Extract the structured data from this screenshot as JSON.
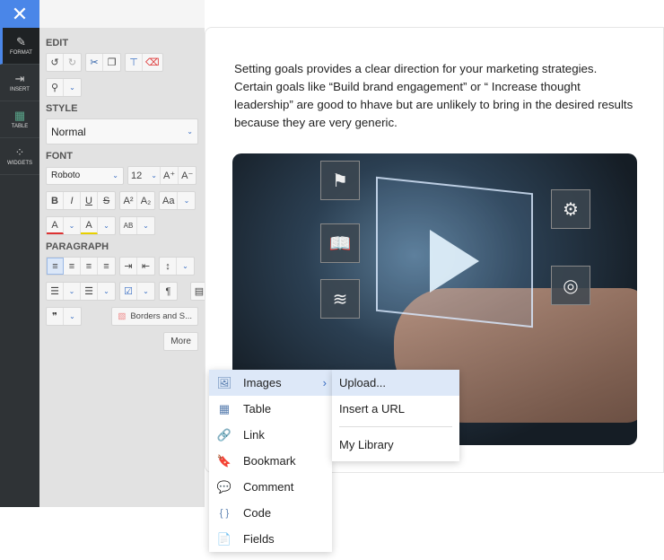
{
  "close_label": "✕",
  "rail": [
    {
      "label": "FORMAT",
      "icon": "✎"
    },
    {
      "label": "INSERT",
      "icon": "⇥"
    },
    {
      "label": "TABLE",
      "icon": "▦"
    },
    {
      "label": "WIDGETS",
      "icon": "⁘"
    }
  ],
  "panel": {
    "edit": "EDIT",
    "style": "STYLE",
    "style_value": "Normal",
    "font": "FONT",
    "font_value": "Roboto",
    "size_value": "12",
    "paragraph": "PARAGRAPH",
    "borders": "Borders and S...",
    "more": "More"
  },
  "doc": {
    "text": "Setting goals provides a clear direction for your marketing strategies. Certain goals like “Build brand engagement” or “ Increase thought leadership” are good to hhave but are unlikely to bring in the desired results because they are very generic."
  },
  "menu": [
    {
      "label": "Images",
      "icon": "🖼"
    },
    {
      "label": "Table",
      "icon": "▦"
    },
    {
      "label": "Link",
      "icon": "🔗"
    },
    {
      "label": "Bookmark",
      "icon": "🔖"
    },
    {
      "label": "Comment",
      "icon": "💬"
    },
    {
      "label": "Code",
      "icon": "{ }"
    },
    {
      "label": "Fields",
      "icon": "📄"
    }
  ],
  "submenu": {
    "upload": "Upload...",
    "url": "Insert a URL",
    "library": "My Library"
  }
}
